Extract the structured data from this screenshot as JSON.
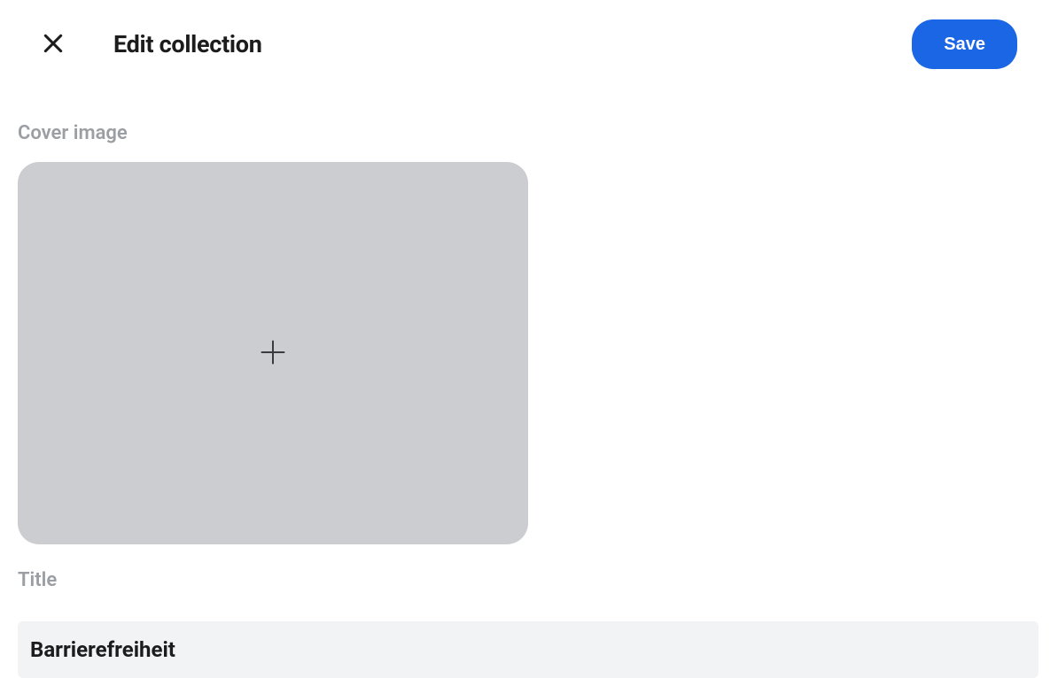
{
  "header": {
    "title": "Edit collection",
    "save_label": "Save"
  },
  "cover": {
    "label": "Cover image"
  },
  "title_field": {
    "label": "Title",
    "value": "Barrierefreiheit"
  }
}
